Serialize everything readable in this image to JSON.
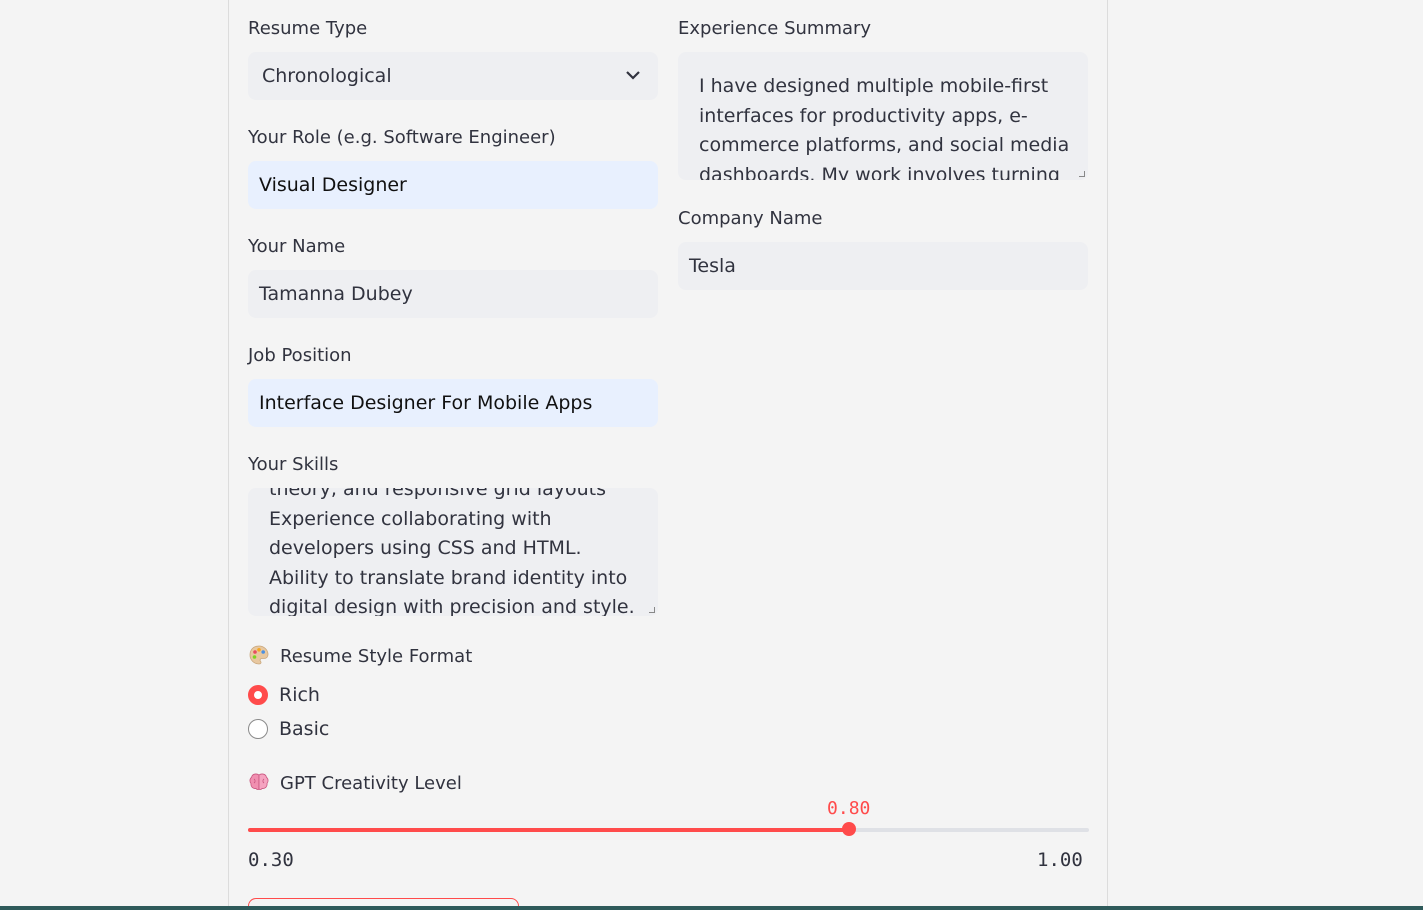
{
  "form": {
    "resume_type": {
      "label": "Resume Type",
      "value": "Chronological"
    },
    "role": {
      "label": "Your Role (e.g. Software Engineer)",
      "value": "Visual Designer"
    },
    "name": {
      "label": "Your Name",
      "value": "Tamanna Dubey"
    },
    "job_position": {
      "label": "Job Position",
      "value": "Interface Designer For Mobile Apps"
    },
    "skills": {
      "label": "Your Skills",
      "value": "theory, and responsive grid layouts\nExperience collaborating with\ndevelopers using CSS and HTML.\nAbility to translate brand identity into\ndigital design with precision and style."
    },
    "experience_summary": {
      "label": "Experience Summary",
      "value": "I have designed multiple mobile-first\ninterfaces for productivity apps, e-\ncommerce platforms, and social media\ndashboards. My work involves turning"
    },
    "company": {
      "label": "Company Name",
      "value": "Tesla"
    },
    "style_format": {
      "label": "Resume Style Format",
      "icon": "palette-icon",
      "options": [
        "Rich",
        "Basic"
      ],
      "selected": "Rich"
    },
    "creativity": {
      "label": "GPT Creativity Level",
      "icon": "brain-icon",
      "min": "0.30",
      "max": "1.00",
      "value": "0.80",
      "value_num": 0.8,
      "min_num": 0.3,
      "max_num": 1.0
    }
  },
  "colors": {
    "accent": "#ff4b4b",
    "field_bg": "#eeeff2",
    "autofill_bg": "#e8f0fe"
  }
}
